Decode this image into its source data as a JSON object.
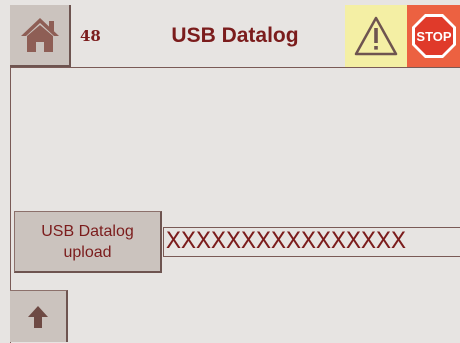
{
  "header": {
    "screen_number": "48",
    "title": "USB Datalog",
    "stop_text": "STOP"
  },
  "icons": {
    "home": "home-icon",
    "warning": "warning-icon",
    "stop": "stop-sign-icon",
    "up": "up-arrow-icon"
  },
  "main": {
    "upload_button_line1": "USB Datalog",
    "upload_button_line2": "upload",
    "status_value": "XXXXXXXXXXXXXXXX"
  },
  "colors": {
    "background": "#e7e4e2",
    "button": "#cbc3be",
    "text": "#7b1c1c",
    "warning_bg": "#f4efa4",
    "stop_bg": "#ec6141"
  }
}
